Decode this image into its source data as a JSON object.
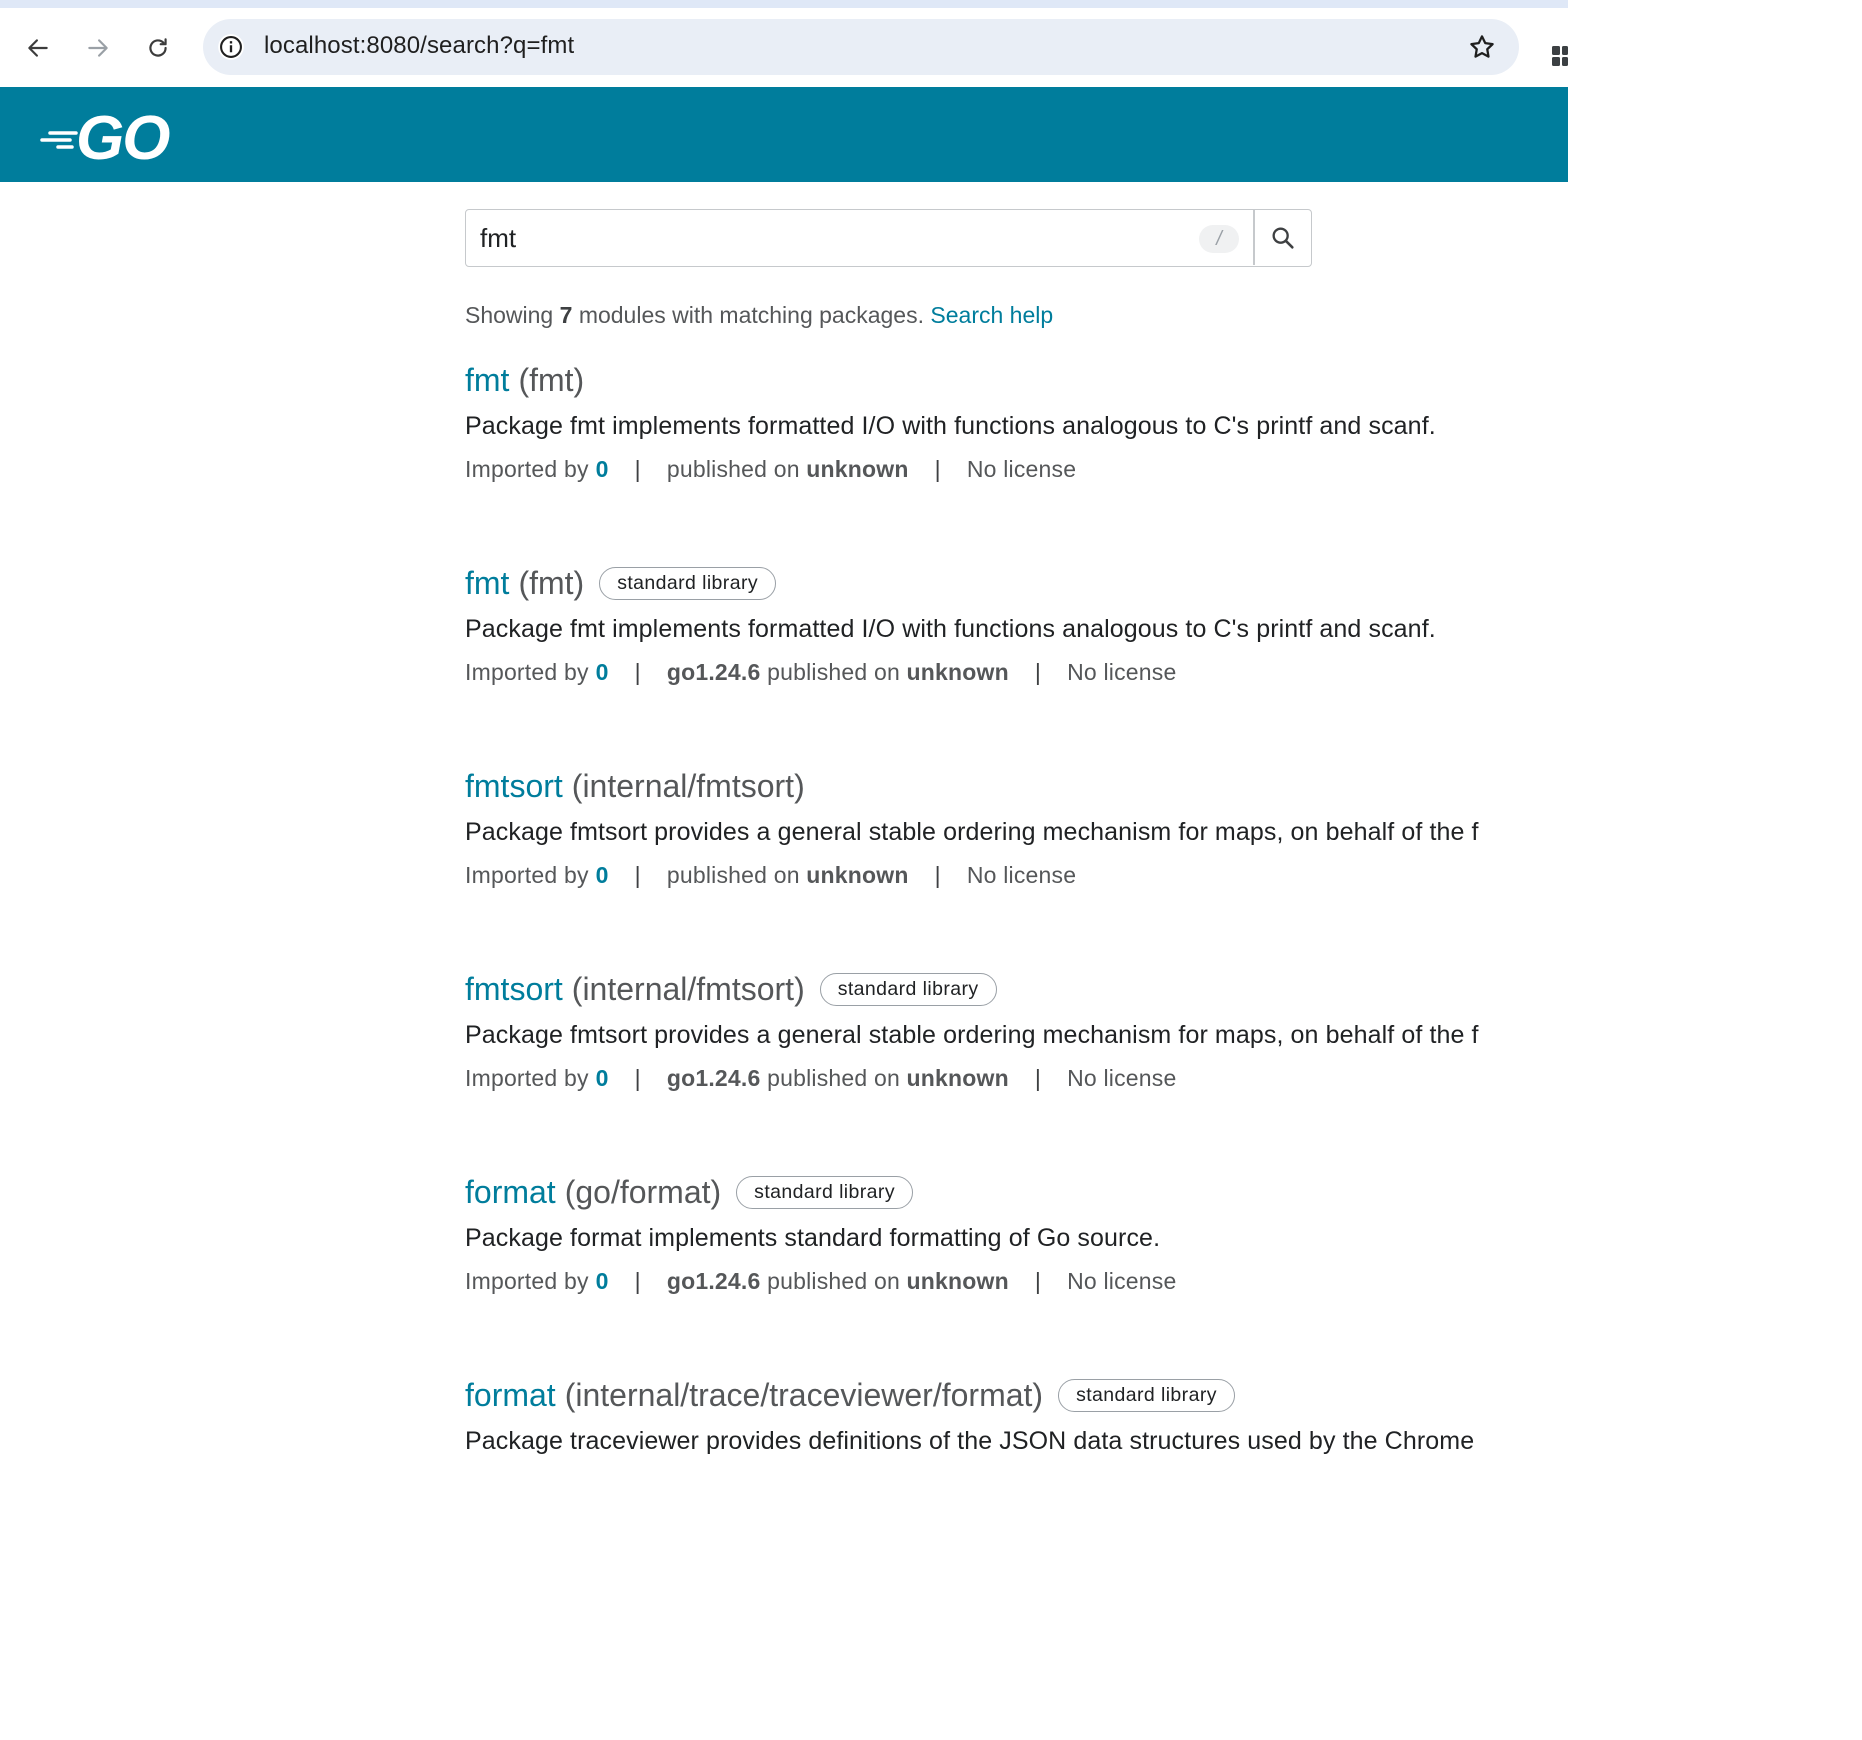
{
  "browser": {
    "url": "localhost:8080/search?q=fmt"
  },
  "header": {
    "logo_text": "GO"
  },
  "search": {
    "query": "fmt",
    "shortcut_hint": "/"
  },
  "summary": {
    "prefix": "Showing",
    "count": "7",
    "suffix": "modules with matching packages.",
    "help_link": "Search help"
  },
  "labels": {
    "imported_by": "Imported by",
    "published_on": "published on",
    "separator": "|"
  },
  "results": [
    {
      "name": "fmt",
      "path": "(fmt)",
      "badge": "",
      "description": "Package fmt implements formatted I/O with functions analogous to C's printf and scanf.",
      "imported_by": "0",
      "version": "",
      "published": "unknown",
      "license": "No license"
    },
    {
      "name": "fmt",
      "path": "(fmt)",
      "badge": "standard library",
      "description": "Package fmt implements formatted I/O with functions analogous to C's printf and scanf.",
      "imported_by": "0",
      "version": "go1.24.6",
      "published": "unknown",
      "license": "No license"
    },
    {
      "name": "fmtsort",
      "path": "(internal/fmtsort)",
      "badge": "",
      "description": "Package fmtsort provides a general stable ordering mechanism for maps, on behalf of the f",
      "imported_by": "0",
      "version": "",
      "published": "unknown",
      "license": "No license"
    },
    {
      "name": "fmtsort",
      "path": "(internal/fmtsort)",
      "badge": "standard library",
      "description": "Package fmtsort provides a general stable ordering mechanism for maps, on behalf of the f",
      "imported_by": "0",
      "version": "go1.24.6",
      "published": "unknown",
      "license": "No license"
    },
    {
      "name": "format",
      "path": "(go/format)",
      "badge": "standard library",
      "description": "Package format implements standard formatting of Go source.",
      "imported_by": "0",
      "version": "go1.24.6",
      "published": "unknown",
      "license": "No license"
    },
    {
      "name": "format",
      "path": "(internal/trace/traceviewer/format)",
      "badge": "standard library",
      "description": "Package traceviewer provides definitions of the JSON data structures used by the Chrome",
      "imported_by": "",
      "version": "",
      "published": "",
      "license": ""
    }
  ],
  "colors": {
    "go_blue": "#007d9c",
    "omnibox_bg": "#e9eef6",
    "text": "#202224",
    "muted_text": "#555759"
  }
}
